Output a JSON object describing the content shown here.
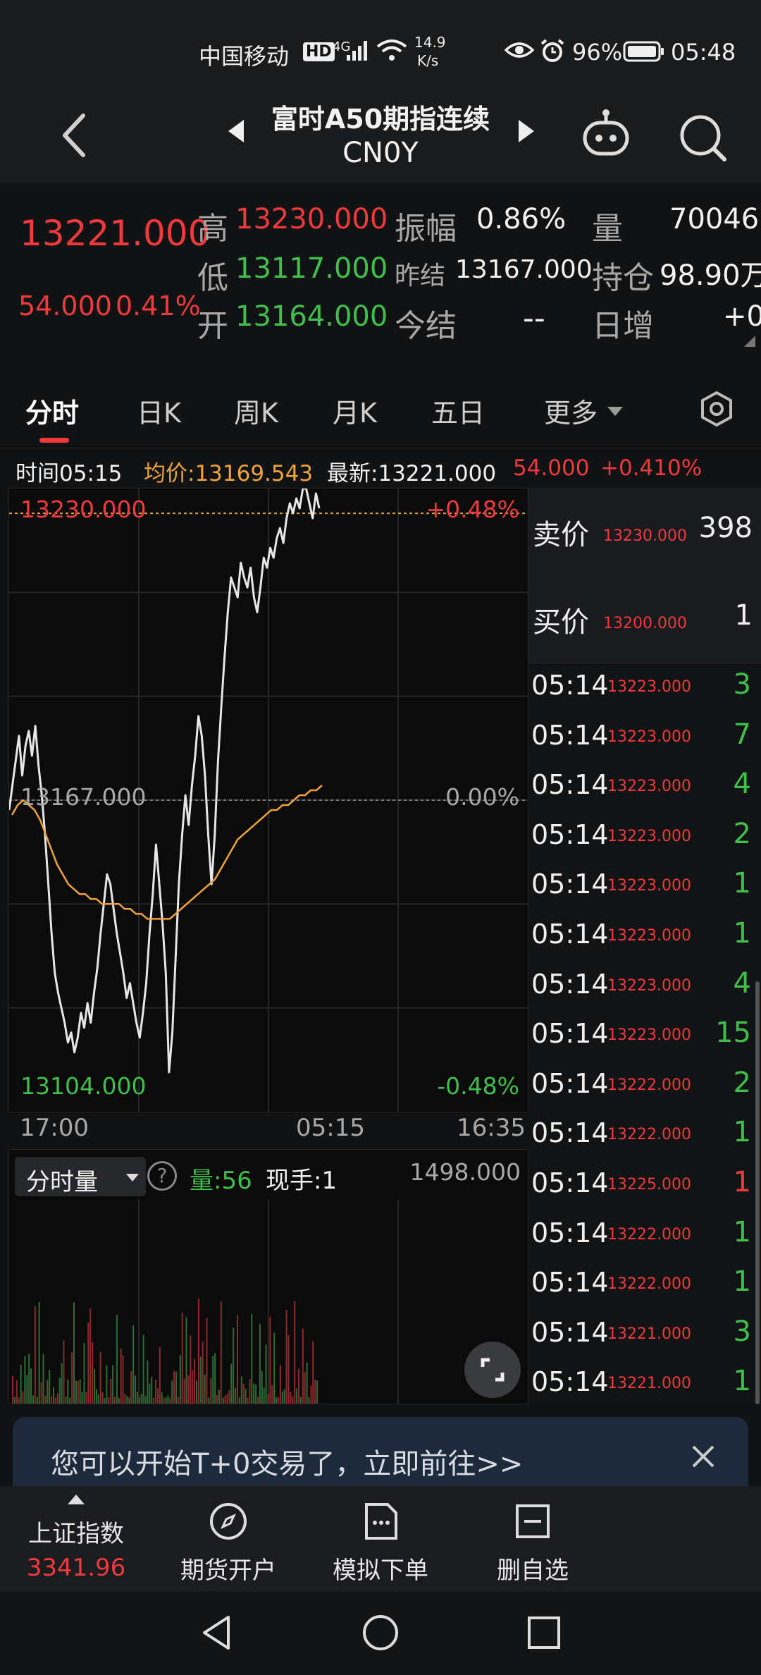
{
  "status_bar": {
    "carrier": "中国移动",
    "hd": "HD",
    "network": "4G",
    "speed_value": "14.9",
    "speed_unit": "K/s",
    "battery": "96%",
    "time": "05:48"
  },
  "header": {
    "title": "富时A50期指连续",
    "code": "CN0Y"
  },
  "quote": {
    "last_price": "13221.000",
    "change": "54.000",
    "change_pct": "0.41%",
    "high_label": "高",
    "high_value": "13230.000",
    "low_label": "低",
    "low_value": "13117.000",
    "open_label": "开",
    "open_value": "13164.000",
    "amplitude_label": "振幅",
    "amplitude_value": "0.86%",
    "prev_settle_label": "昨结",
    "prev_settle_value": "13167.000",
    "today_settle_label": "今结",
    "today_settle_value": "--",
    "volume_label": "量",
    "volume_value": "70046",
    "oi_label": "持仓",
    "oi_value": "98.90万",
    "daily_inc_label": "日增",
    "daily_inc_value": "+0"
  },
  "tabs": [
    {
      "label": "分时",
      "active": true
    },
    {
      "label": "日K",
      "active": false
    },
    {
      "label": "周K",
      "active": false
    },
    {
      "label": "月K",
      "active": false
    },
    {
      "label": "五日",
      "active": false
    },
    {
      "label": "更多",
      "active": false
    }
  ],
  "info_line": {
    "time": "时间05:15",
    "avg": "均价:13169.543",
    "latest": "最新:13221.000",
    "change": "54.000",
    "change_pct": "+0.410%"
  },
  "chart_data": {
    "type": "line",
    "price_top_label": "13230.000",
    "price_mid_label": "13167.000",
    "price_bottom_label": "13104.000",
    "pct_top_label": "+0.48%",
    "pct_mid_label": "0.00%",
    "pct_bottom_label": "-0.48%",
    "x_tick_labels": [
      "17:00",
      "05:15",
      "16:35"
    ],
    "ylim": [
      13104,
      13230
    ],
    "prev_close": 13167,
    "series": [
      {
        "color": "#e6e6e6",
        "values": [
          13165,
          13170,
          13175,
          13180,
          13172,
          13178,
          13181,
          13176,
          13182,
          13174,
          13168,
          13160,
          13150,
          13140,
          13132,
          13128,
          13125,
          13122,
          13118,
          13120,
          13116,
          13119,
          13124,
          13121,
          13126,
          13122,
          13128,
          13133,
          13140,
          13146,
          13152,
          13150,
          13145,
          13140,
          13136,
          13132,
          13127,
          13130,
          13126,
          13122,
          13119,
          13124,
          13130,
          13140,
          13148,
          13158,
          13150,
          13142,
          13132,
          13112,
          13120,
          13135,
          13150,
          13160,
          13168,
          13162,
          13170,
          13176,
          13184,
          13180,
          13172,
          13160,
          13150,
          13160,
          13175,
          13186,
          13196,
          13205,
          13212,
          13210,
          13208,
          13215,
          13212,
          13210,
          13214,
          13208,
          13205,
          13210,
          13216,
          13214,
          13218,
          13216,
          13220,
          13222,
          13219,
          13224,
          13227,
          13225,
          13228,
          13226,
          13230,
          13230,
          13227,
          13224,
          13229,
          13226
        ]
      },
      {
        "color": "#f1a33a",
        "values": [
          13164,
          13166,
          13167,
          13166,
          13165,
          13163,
          13160,
          13157,
          13154,
          13152,
          13150,
          13149,
          13148,
          13148,
          13147,
          13147,
          13146,
          13146,
          13146,
          13146,
          13145,
          13145,
          13144,
          13144,
          13143,
          13143,
          13143,
          13143,
          13143,
          13144,
          13145,
          13146,
          13147,
          13148,
          13149,
          13150,
          13151,
          13153,
          13155,
          13157,
          13159,
          13160,
          13161,
          13162,
          13163,
          13164,
          13165,
          13165,
          13166,
          13166,
          13167,
          13168,
          13168,
          13169,
          13169,
          13170
        ]
      }
    ]
  },
  "volume_panel": {
    "selector_label": "分时量",
    "volume_label": "量:56",
    "current_hand_label": "现手:1",
    "max_label": "1498.000"
  },
  "order_book": {
    "ask_label": "卖价",
    "ask_price": "13230.000",
    "ask_qty": "398",
    "bid_label": "买价",
    "bid_price": "13200.000",
    "bid_qty": "1"
  },
  "trades": [
    {
      "time": "05:14",
      "price": "13223.000",
      "qty": "3",
      "color": "green"
    },
    {
      "time": "05:14",
      "price": "13223.000",
      "qty": "7",
      "color": "green"
    },
    {
      "time": "05:14",
      "price": "13223.000",
      "qty": "4",
      "color": "green"
    },
    {
      "time": "05:14",
      "price": "13223.000",
      "qty": "2",
      "color": "green"
    },
    {
      "time": "05:14",
      "price": "13223.000",
      "qty": "1",
      "color": "green"
    },
    {
      "time": "05:14",
      "price": "13223.000",
      "qty": "1",
      "color": "green"
    },
    {
      "time": "05:14",
      "price": "13223.000",
      "qty": "4",
      "color": "green"
    },
    {
      "time": "05:14",
      "price": "13223.000",
      "qty": "15",
      "color": "green"
    },
    {
      "time": "05:14",
      "price": "13222.000",
      "qty": "2",
      "color": "green"
    },
    {
      "time": "05:14",
      "price": "13222.000",
      "qty": "1",
      "color": "green"
    },
    {
      "time": "05:14",
      "price": "13225.000",
      "qty": "1",
      "color": "red"
    },
    {
      "time": "05:14",
      "price": "13222.000",
      "qty": "1",
      "color": "green"
    },
    {
      "time": "05:14",
      "price": "13222.000",
      "qty": "1",
      "color": "green"
    },
    {
      "time": "05:14",
      "price": "13221.000",
      "qty": "3",
      "color": "green"
    },
    {
      "time": "05:14",
      "price": "13221.000",
      "qty": "1",
      "color": "green"
    }
  ],
  "banner": {
    "text": "您可以开始T+0交易了，立即前往>>"
  },
  "bottom_nav": {
    "index_name": "上证指数",
    "index_value": "3341.96",
    "items": [
      "期货开户",
      "模拟下单",
      "删自选"
    ]
  },
  "colors": {
    "up": "#f0393d",
    "down": "#3fbf4b",
    "avg_line": "#f1a33a",
    "price_line": "#e6e6e6"
  }
}
